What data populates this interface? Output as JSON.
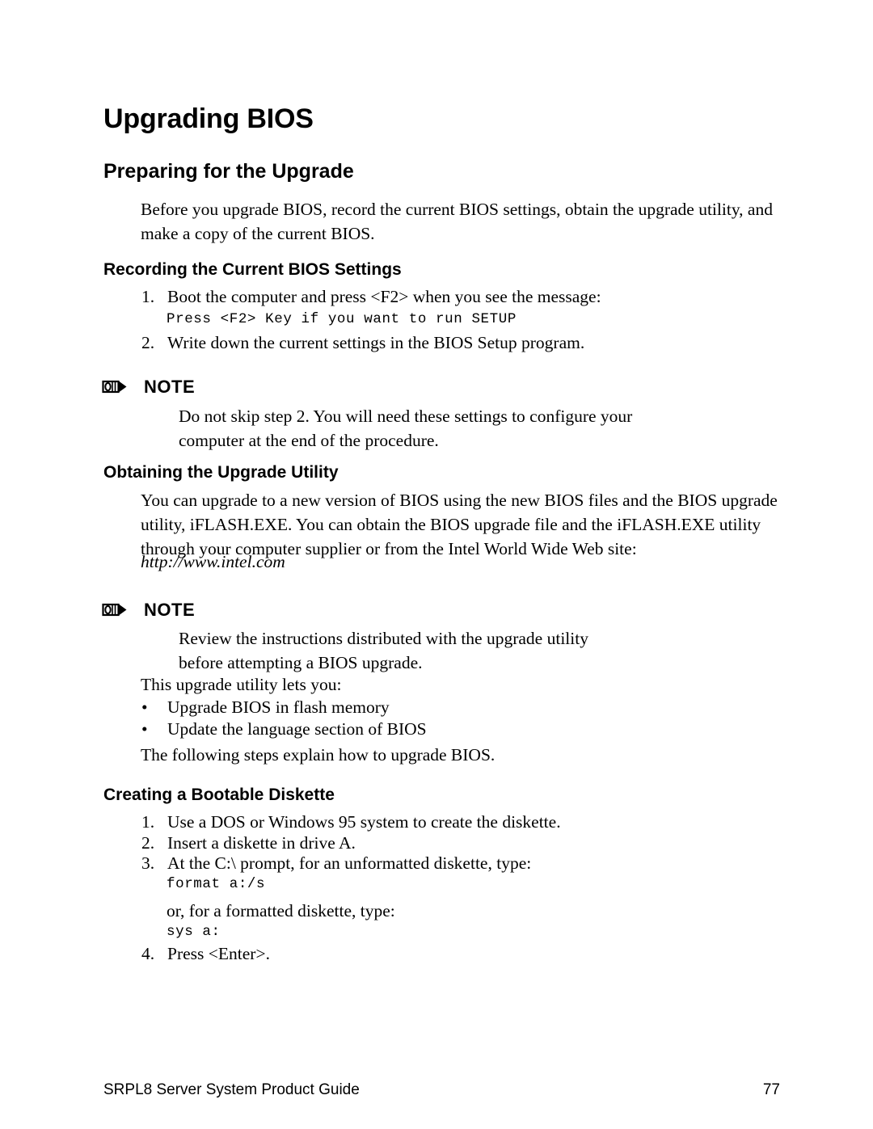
{
  "document": {
    "title": "Upgrading BIOS",
    "sections": {
      "preparing": {
        "heading": "Preparing for the Upgrade",
        "intro": "Before you upgrade BIOS, record the current BIOS settings, obtain the upgrade utility, and make a copy of the current BIOS."
      },
      "recording": {
        "heading": "Recording the Current BIOS Settings",
        "step1_num": "1.",
        "step1_text": "Boot the computer and press <F2> when you see the message:",
        "code1": "Press <F2> Key if you want to run SETUP",
        "step2_num": "2.",
        "step2_text": "Write down the current settings in the BIOS Setup program."
      },
      "note1": {
        "label": "NOTE",
        "body": "Do not skip step 2.  You will need these settings to configure your computer at the end of the procedure."
      },
      "obtaining": {
        "heading": "Obtaining the Upgrade Utility",
        "paragraph": "You can upgrade to a new version of BIOS using the new BIOS files and the BIOS upgrade utility, iFLASH.EXE.  You can obtain the BIOS upgrade file and the iFLASH.EXE utility through your computer supplier or from the Intel World Wide Web site:",
        "url": "http://www.intel.com"
      },
      "note2": {
        "label": "NOTE",
        "body": "Review the instructions distributed with the upgrade utility before attempting a BIOS upgrade."
      },
      "utility_list": {
        "lead_in": "This upgrade utility lets you:",
        "bullet_marker": "•",
        "bullets": [
          "Upgrade BIOS in flash memory",
          "Update the language section of BIOS"
        ],
        "closing": "The following steps explain how to upgrade BIOS."
      },
      "bootable": {
        "heading": "Creating a Bootable Diskette",
        "step1_num": "1.",
        "step1_text": "Use a DOS or Windows 95 system to create the diskette.",
        "step2_num": "2.",
        "step2_text": "Insert a diskette in drive A.",
        "step3_num": "3.",
        "step3_text": "At the C:\\ prompt, for an unformatted diskette, type:",
        "code_format": "format a:/s",
        "mid_text": "or, for a formatted diskette, type:",
        "code_sys": "sys a:",
        "step4_num": "4.",
        "step4_text": "Press <Enter>."
      }
    }
  },
  "footer": {
    "guide_name": "SRPL8 Server System Product Guide",
    "page_number": "77"
  },
  "icons": {
    "note_pencil": "pencil-icon"
  },
  "colors": {
    "page_background": "#ffffff",
    "text": "#000000"
  }
}
